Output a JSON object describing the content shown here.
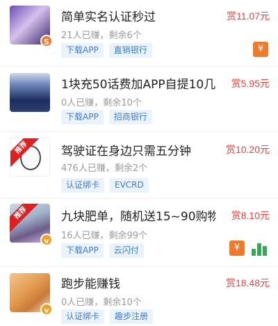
{
  "tasks": [
    {
      "title": "简单实名认证秒过",
      "reward": "赏11.07元",
      "meta": "21人已赚，剩余6个",
      "tags": [
        "下载APP",
        "直销银行"
      ],
      "badge": "S",
      "icons": [
        "red-envelope-icon"
      ]
    },
    {
      "title": "1块充50话费加APP自提10几",
      "reward": "赏5.95元",
      "meta": "0人已赚，剩余10个",
      "tags": [
        "下载APP",
        "招商银行"
      ],
      "icons": []
    },
    {
      "title": "驾驶证在身边只需五分钟",
      "reward": "赏10.20元",
      "meta": "476人已赚，剩余2个",
      "tags": [
        "认证绑卡",
        "EVCRD"
      ],
      "ribbon": "推荐",
      "icons": []
    },
    {
      "title": "九块肥单，随机送15~90购物...",
      "reward": "赏8.10元",
      "meta": "16人已赚，剩余99个",
      "tags": [
        "下载APP",
        "云闪付"
      ],
      "ribbon": "推荐",
      "badge": "v",
      "icons": [
        "red-envelope-icon",
        "bar-chart-icon"
      ]
    },
    {
      "title": "跑步能赚钱",
      "reward": "赏18.48元",
      "meta": "0人已赚，剩余10个",
      "tags": [
        "认证绑卡",
        "趣步注册"
      ],
      "badge": "v",
      "icons": []
    }
  ],
  "colors": {
    "reward": "#e8453c",
    "tag_text": "#3d7fd1",
    "tag_bg": "#eaf2fc",
    "ribbon": "#e02020",
    "badge_orange": "#f0a020",
    "chart_green": "#34a853"
  }
}
